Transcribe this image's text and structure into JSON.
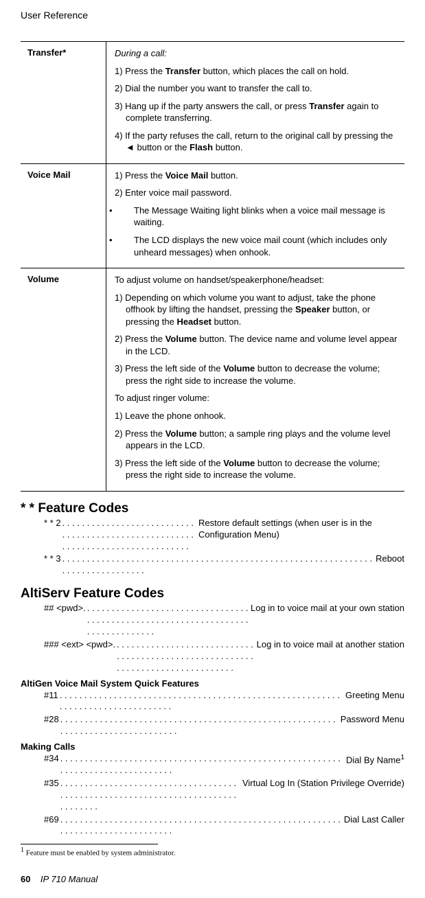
{
  "header": {
    "running_head": "User Reference"
  },
  "table": {
    "rows": [
      {
        "label": "Transfer*",
        "lines": [
          {
            "type": "italic",
            "text": "During a call:"
          },
          {
            "type": "indent",
            "html": "1) Press the <b>Transfer</b> button, which places the call on hold."
          },
          {
            "type": "indent",
            "html": "2) Dial the number you want to transfer the call to."
          },
          {
            "type": "indent",
            "html": "3) Hang up if the party answers the call, or press <b>Transfer</b> again to complete transferring."
          },
          {
            "type": "indent",
            "html": "4) If the party refuses the call, return to the original call by pressing the <span class='arrow'>◄</span> button or the <b>Flash</b> button."
          }
        ]
      },
      {
        "label": "Voice Mail",
        "lines": [
          {
            "type": "indent",
            "html": "1) Press the <b>Voice Mail</b> button."
          },
          {
            "type": "indent",
            "html": "2) Enter voice mail password."
          },
          {
            "type": "bullet",
            "html": "The Message Waiting light blinks when a voice mail message is waiting."
          },
          {
            "type": "bullet",
            "html": "The LCD displays the new voice mail count (which includes only unheard messages) when onhook."
          }
        ]
      },
      {
        "label": "Volume",
        "lines": [
          {
            "type": "plain",
            "html": "To adjust volume on handset/speakerphone/headset:"
          },
          {
            "type": "indent",
            "html": "1) Depending on which volume you want to adjust, take the phone offhook by lifting the handset, pressing the <b>Speaker</b> button, or pressing the <b>Headset</b> button."
          },
          {
            "type": "indent",
            "html": "2) Press the <b>Volume</b> button. The device name and volume level appear in the LCD."
          },
          {
            "type": "indent",
            "html": "3) Press the left side of the <b>Volume</b> button to decrease the volume; press the right side to increase the volume."
          },
          {
            "type": "plain",
            "html": "To adjust ringer volume:"
          },
          {
            "type": "indent",
            "html": "1) Leave the phone onhook."
          },
          {
            "type": "indent",
            "html": "2) Press the <b>Volume</b> button; a sample ring plays and the volume level appears in the LCD."
          },
          {
            "type": "indent",
            "html": "3) Press the left side of the <b>Volume</b> button to decrease the volume; press the right side to increase the volume."
          }
        ]
      }
    ]
  },
  "sections": {
    "star": {
      "title": "* * Feature Codes",
      "items": [
        {
          "key": "* * 2",
          "desc": "Restore default settings (when user is in the Configuration Menu)"
        },
        {
          "key": "* * 3",
          "desc": "Reboot"
        }
      ]
    },
    "altiserv": {
      "title": "AltiServ Feature Codes",
      "items": [
        {
          "key": "## <pwd>.",
          "desc": "Log in to voice mail at your own station"
        },
        {
          "key": "### <ext> <pwd>.",
          "desc": "Log in to voice mail at another station"
        }
      ],
      "sub1": {
        "title": "AltiGen Voice Mail System Quick Features",
        "items": [
          {
            "key": "#11",
            "desc": "Greeting Menu"
          },
          {
            "key": "#28",
            "desc": "Password Menu"
          }
        ]
      },
      "sub2": {
        "title": "Making Calls",
        "items": [
          {
            "key": "#34",
            "desc_html": "Dial By Name<span class='sup'>1</span>"
          },
          {
            "key": "#35",
            "desc": "Virtual Log In (Station Privilege Override)"
          },
          {
            "key": "#69",
            "desc": "Dial Last Caller"
          }
        ]
      }
    }
  },
  "footnote": {
    "marker": "1",
    "text": "Feature must be enabled by system administrator."
  },
  "footer": {
    "page": "60",
    "title": "IP 710 Manual"
  }
}
